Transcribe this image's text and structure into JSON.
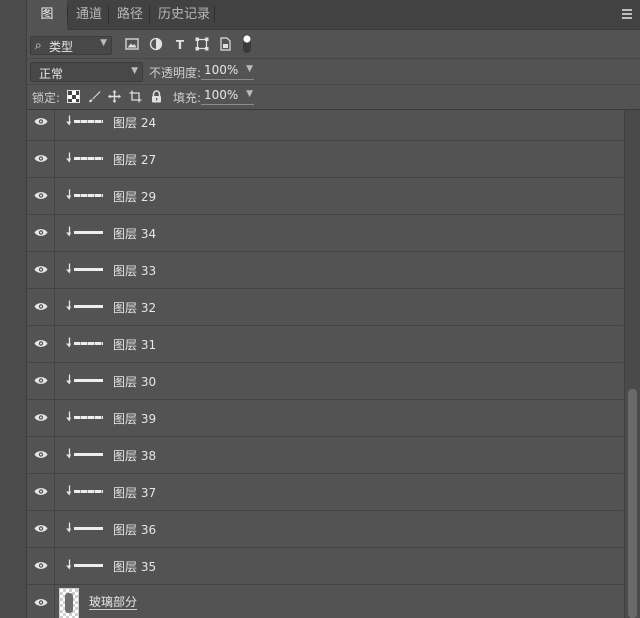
{
  "tabs": [
    {
      "label": "图层",
      "active": true
    },
    {
      "label": "通道",
      "active": false
    },
    {
      "label": "路径",
      "active": false
    },
    {
      "label": "历史记录",
      "active": false
    }
  ],
  "filter": {
    "kind_label": "类型",
    "icons": [
      "image-filter-icon",
      "adjustment-filter-icon",
      "type-filter-icon",
      "shape-filter-icon",
      "smart-object-filter-icon",
      "filter-toggle-icon"
    ]
  },
  "blend": {
    "mode": "正常",
    "opacity_label": "不透明度:",
    "opacity_value": "100%"
  },
  "lock": {
    "label": "锁定:",
    "icons": [
      "lock-transparent-pixels-icon",
      "lock-image-pixels-icon",
      "lock-position-icon",
      "lock-artboard-icon",
      "lock-all-icon"
    ],
    "fill_label": "填充:",
    "fill_value": "100%"
  },
  "layers": [
    {
      "name": "图层 24",
      "visible": true,
      "clipped": true,
      "dashed": true
    },
    {
      "name": "图层 27",
      "visible": true,
      "clipped": true,
      "dashed": true
    },
    {
      "name": "图层 29",
      "visible": true,
      "clipped": true,
      "dashed": true
    },
    {
      "name": "图层 34",
      "visible": true,
      "clipped": true,
      "dashed": false
    },
    {
      "name": "图层 33",
      "visible": true,
      "clipped": true,
      "dashed": false
    },
    {
      "name": "图层 32",
      "visible": true,
      "clipped": true,
      "dashed": false
    },
    {
      "name": "图层 31",
      "visible": true,
      "clipped": true,
      "dashed": true
    },
    {
      "name": "图层 30",
      "visible": true,
      "clipped": true,
      "dashed": false
    },
    {
      "name": "图层 39",
      "visible": true,
      "clipped": true,
      "dashed": true
    },
    {
      "name": "图层 38",
      "visible": true,
      "clipped": true,
      "dashed": false
    },
    {
      "name": "图层 37",
      "visible": true,
      "clipped": true,
      "dashed": true
    },
    {
      "name": "图层 36",
      "visible": true,
      "clipped": true,
      "dashed": false
    },
    {
      "name": "图层 35",
      "visible": true,
      "clipped": true,
      "dashed": false
    }
  ],
  "group_layer": {
    "name": "玻璃部分",
    "visible": true
  },
  "scrollbar": {
    "position": 0.55,
    "visible_fraction": 0.45
  }
}
